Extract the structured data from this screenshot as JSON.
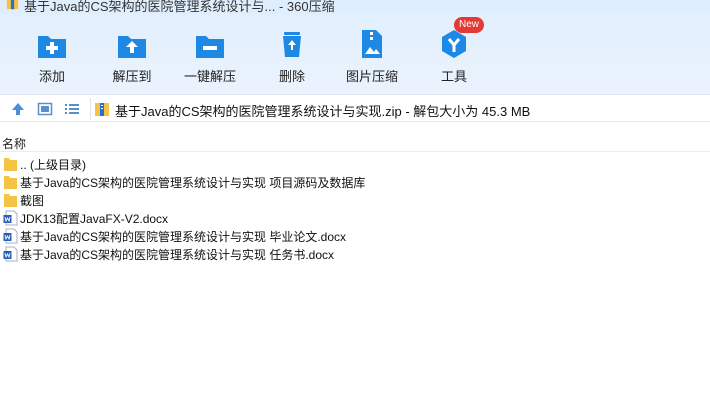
{
  "window": {
    "title": "基于Java的CS架构的医院管理系统设计与... - 360压缩"
  },
  "toolbar": {
    "add_label": "添加",
    "extract_to_label": "解压到",
    "one_click_extract_label": "一键解压",
    "delete_label": "删除",
    "image_compress_label": "图片压缩",
    "tools_label": "工具",
    "tools_badge": "New"
  },
  "address": {
    "path": "基于Java的CS架构的医院管理系统设计与实现.zip - 解包大小为 45.3 MB"
  },
  "list": {
    "name_header": "名称",
    "items": [
      {
        "name": ".. (上级目录)",
        "kind": "folder"
      },
      {
        "name": "基于Java的CS架构的医院管理系统设计与实现 项目源码及数据库",
        "kind": "folder"
      },
      {
        "name": "截图",
        "kind": "folder"
      },
      {
        "name": "JDK13配置JavaFX-V2.docx",
        "kind": "docx"
      },
      {
        "name": "基于Java的CS架构的医院管理系统设计与实现 毕业论文.docx",
        "kind": "docx"
      },
      {
        "name": "基于Java的CS架构的医院管理系统设计与实现 任务书.docx",
        "kind": "docx"
      }
    ]
  },
  "colors": {
    "accent": "#1e88e5",
    "toolbar_bg": "#e6f1fd",
    "badge": "#e53935",
    "folder": "#f5c445"
  }
}
